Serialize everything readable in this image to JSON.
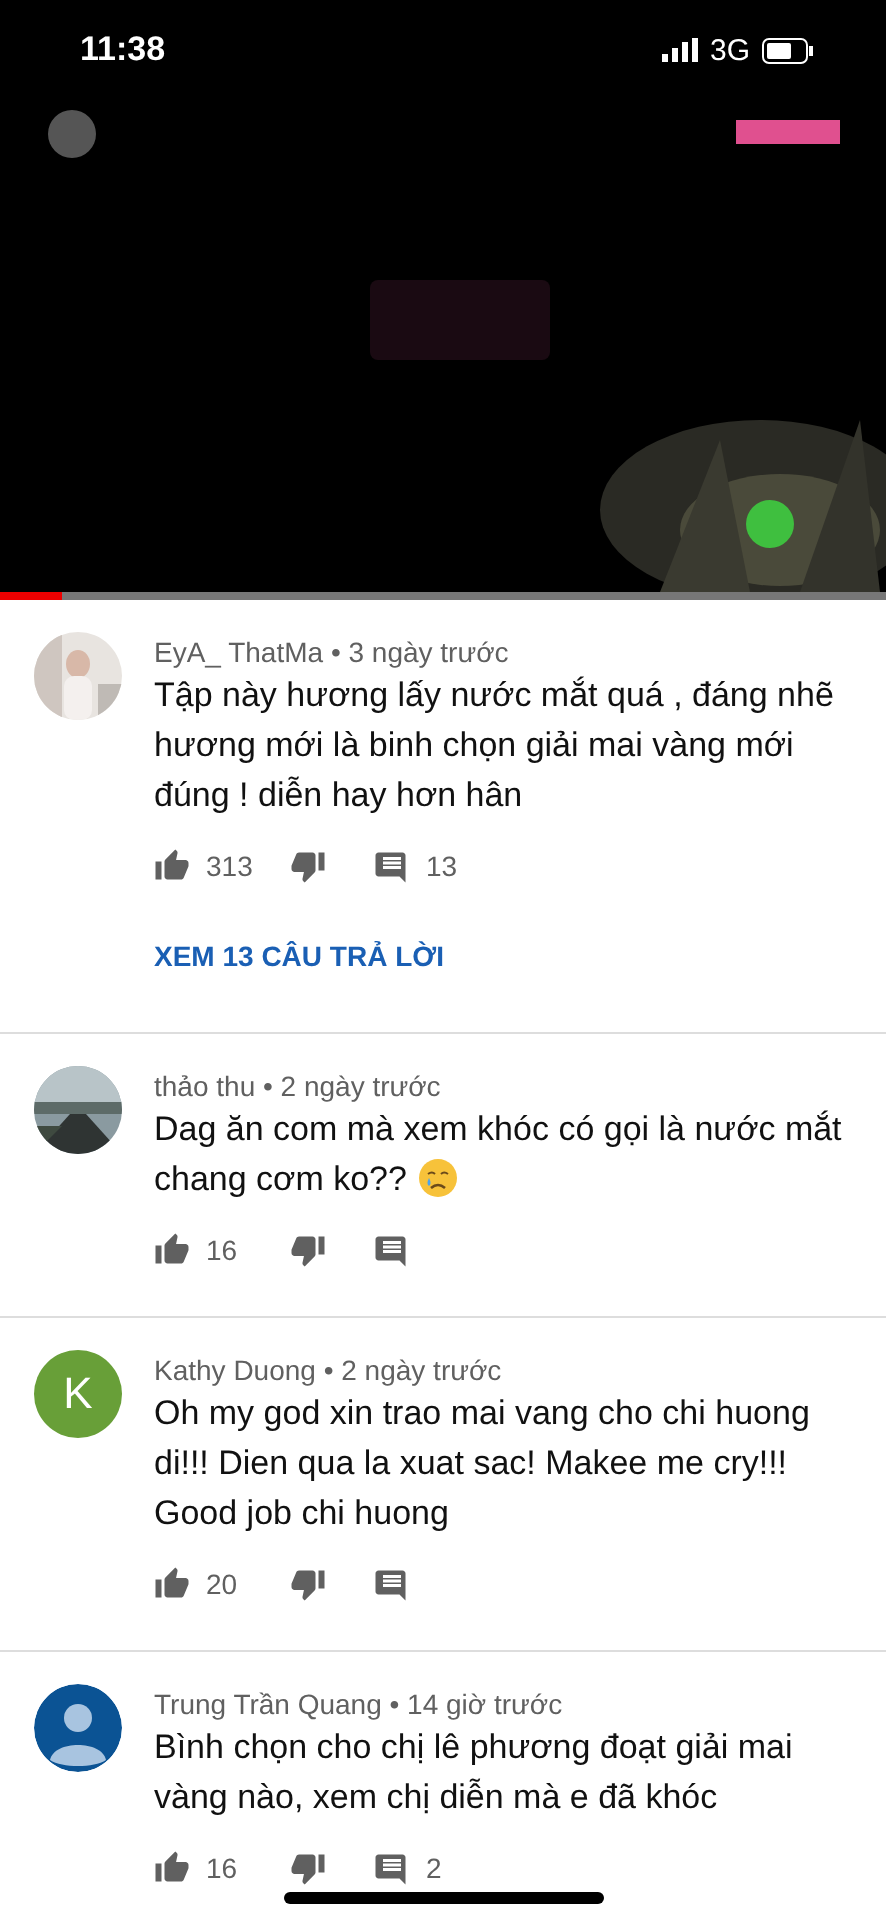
{
  "status_bar": {
    "time": "11:38",
    "network": "3G"
  },
  "video": {
    "kind": "picture",
    "progress": {
      "level": 0.07
    }
  },
  "comments": [
    {
      "meta": "EyA_ ThatMa • 3 ngày trước",
      "text": "Tập này hương lấy nước mắt quá , đáng nhẽ hương mới là binh chọn giải mai vàng mới đúng ! diễn hay hơn hân",
      "crying_emoji": false,
      "likes": "313",
      "replies": "13",
      "replies_link": "XEM 13 CÂU TRẢ LỜI"
    },
    {
      "meta": "thảo thu • 2 ngày trước",
      "text": "Dag ăn com mà xem khóc có gọi là nước mắt chang cơm ko??",
      "crying_emoji": true,
      "likes": "16"
    },
    {
      "meta": "Kathy Duong • 2 ngày trước",
      "avatar": {
        "kind": "letter",
        "letter": "K",
        "color": "#689f38"
      },
      "text": "Oh my god xin trao mai vang cho chi huong di!!! Dien qua la xuat sac! Makee me cry!!! Good job chi huong",
      "crying_emoji": false,
      "likes": "20"
    },
    {
      "meta": "Trung Trần Quang • 14 giờ trước",
      "avatar": {
        "kind": "default",
        "color": "#0b5394"
      },
      "text": "Bình chọn cho chị lê phương đoạt giải mai vàng nào, xem chị diễn mà e đã khóc",
      "crying_emoji": false,
      "likes": "16",
      "replies": "2"
    }
  ]
}
